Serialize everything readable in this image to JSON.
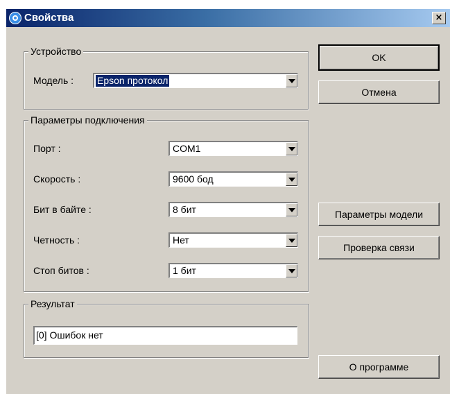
{
  "window": {
    "title": "Свойства",
    "close_label": "×"
  },
  "device": {
    "group_label": "Устройство",
    "model_label": "Модель :",
    "model_value": "Epson протокол"
  },
  "connection": {
    "group_label": "Параметры подключения",
    "fields": [
      {
        "label": "Порт :",
        "value": "COM1"
      },
      {
        "label": "Скорость :",
        "value": "9600 бод"
      },
      {
        "label": "Бит в байте :",
        "value": "8 бит"
      },
      {
        "label": "Четность :",
        "value": "Нет"
      },
      {
        "label": "Стоп битов :",
        "value": "1 бит"
      }
    ]
  },
  "result": {
    "group_label": "Результат",
    "value": "[0] Ошибок нет"
  },
  "buttons": {
    "ok": "OK",
    "cancel": "Отмена",
    "model_params": "Параметры модели",
    "check_connection": "Проверка связи",
    "about": "О программе"
  }
}
